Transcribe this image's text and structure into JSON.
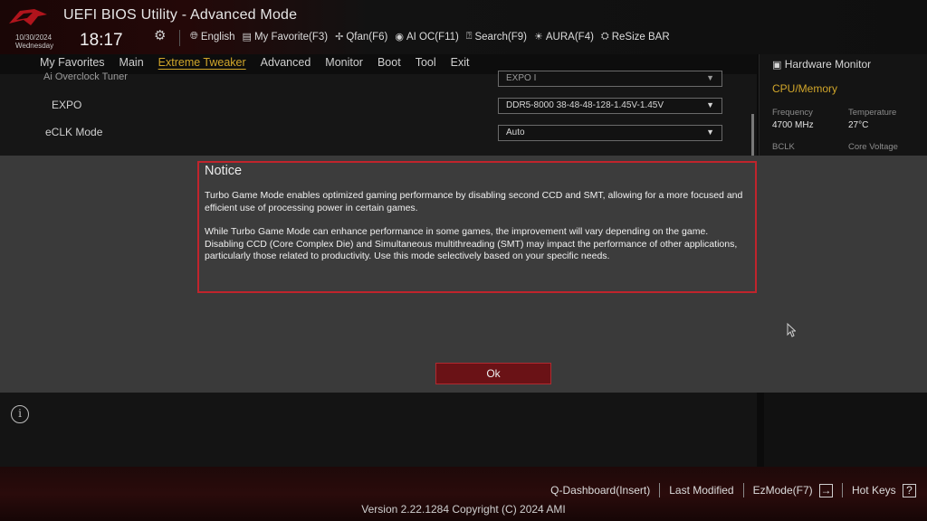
{
  "header": {
    "title": "UEFI BIOS Utility - Advanced Mode",
    "date": "10/30/2024",
    "day": "Wednesday",
    "time": "18:17",
    "toolbar": [
      {
        "label": "English",
        "icon": "globe-icon"
      },
      {
        "label": "My Favorite(F3)",
        "icon": "favorite-icon"
      },
      {
        "label": "Qfan(F6)",
        "icon": "fan-icon"
      },
      {
        "label": "AI OC(F11)",
        "icon": "ai-oc-icon"
      },
      {
        "label": "Search(F9)",
        "icon": "search-icon"
      },
      {
        "label": "AURA(F4)",
        "icon": "aura-icon"
      },
      {
        "label": "ReSize BAR",
        "icon": "resize-bar-icon"
      }
    ]
  },
  "menu": {
    "items": [
      "My Favorites",
      "Main",
      "Extreme Tweaker",
      "Advanced",
      "Monitor",
      "Boot",
      "Tool",
      "Exit"
    ],
    "active": "Extreme Tweaker"
  },
  "settings": {
    "rows": [
      {
        "label": "Ai Overclock Tuner",
        "value": "EXPO I"
      },
      {
        "label": "EXPO",
        "value": "DDR5-8000 38-48-48-128-1.45V-1.45V"
      },
      {
        "label": "eCLK Mode",
        "value": "Auto"
      }
    ]
  },
  "hardware_monitor": {
    "title": "Hardware Monitor",
    "section": "CPU/Memory",
    "frequency_label": "Frequency",
    "frequency_value": "4700 MHz",
    "temperature_label": "Temperature",
    "temperature_value": "27°C",
    "bclk_label": "BCLK",
    "core_voltage_label": "Core Voltage"
  },
  "dialog": {
    "title": "Notice",
    "paragraph1": "Turbo Game Mode enables optimized gaming performance by disabling second CCD and SMT, allowing for a more focused and efficient use of processing power in certain games.",
    "paragraph2": "While Turbo Game Mode can enhance performance in some games, the improvement will vary depending on the game. Disabling CCD (Core Complex Die) and Simultaneous multithreading (SMT) may impact the performance of other applications, particularly those related to productivity. Use this mode selectively based on your specific needs.",
    "ok_label": "Ok"
  },
  "footer": {
    "items": [
      "Q-Dashboard(Insert)",
      "Last Modified",
      "EzMode(F7)",
      "Hot Keys"
    ],
    "version": "Version 2.22.1284 Copyright (C) 2024 AMI"
  },
  "colors": {
    "accent": "#d1a62a",
    "dialog_border": "#c0242c",
    "ok_button": "#6a1216"
  }
}
